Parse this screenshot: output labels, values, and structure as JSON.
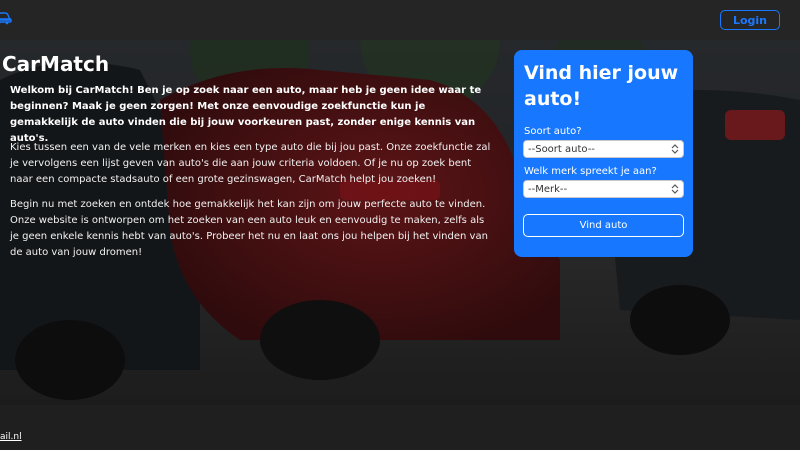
{
  "header": {
    "logo_icon": "car-icon",
    "login_label": "Login",
    "accent_color": "#1a78ff"
  },
  "hero": {
    "title": "CarMatch",
    "paragraphs": {
      "intro_bold": "Welkom bij CarMatch! Ben je op zoek naar een auto, maar heb je geen idee waar te beginnen? Maak je geen zorgen! Met onze eenvoudige zoekfunctie kun je gemakkelijk de auto vinden die bij jouw voorkeuren past, zonder enige kennis van auto's.",
      "p2": "Kies tussen een van de vele merken en kies een type auto die bij jou past. Onze zoekfunctie zal je vervolgens een lijst geven van auto's die aan jouw criteria voldoen. Of je nu op zoek bent naar een compacte stadsauto of een grote gezinswagen, CarMatch helpt jou zoeken!",
      "p3": "Begin nu met zoeken en ontdek hoe gemakkelijk het kan zijn om jouw perfecte auto te vinden. Onze website is ontworpen om het zoeken van een auto leuk en eenvoudig te maken, zelfs als je geen enkele kennis hebt van auto's. Probeer het nu en laat ons jou helpen bij het vinden van de auto van jouw dromen!"
    }
  },
  "search": {
    "title": "Vind hier jouw auto!",
    "type_label": "Soort auto?",
    "type_value": "--Soort auto--",
    "brand_label": "Welk merk spreekt je aan?",
    "brand_value": "--Merk--",
    "submit_label": "Vind auto",
    "card_color": "#1778ff"
  },
  "footer": {
    "email_link": "ail.nl"
  }
}
